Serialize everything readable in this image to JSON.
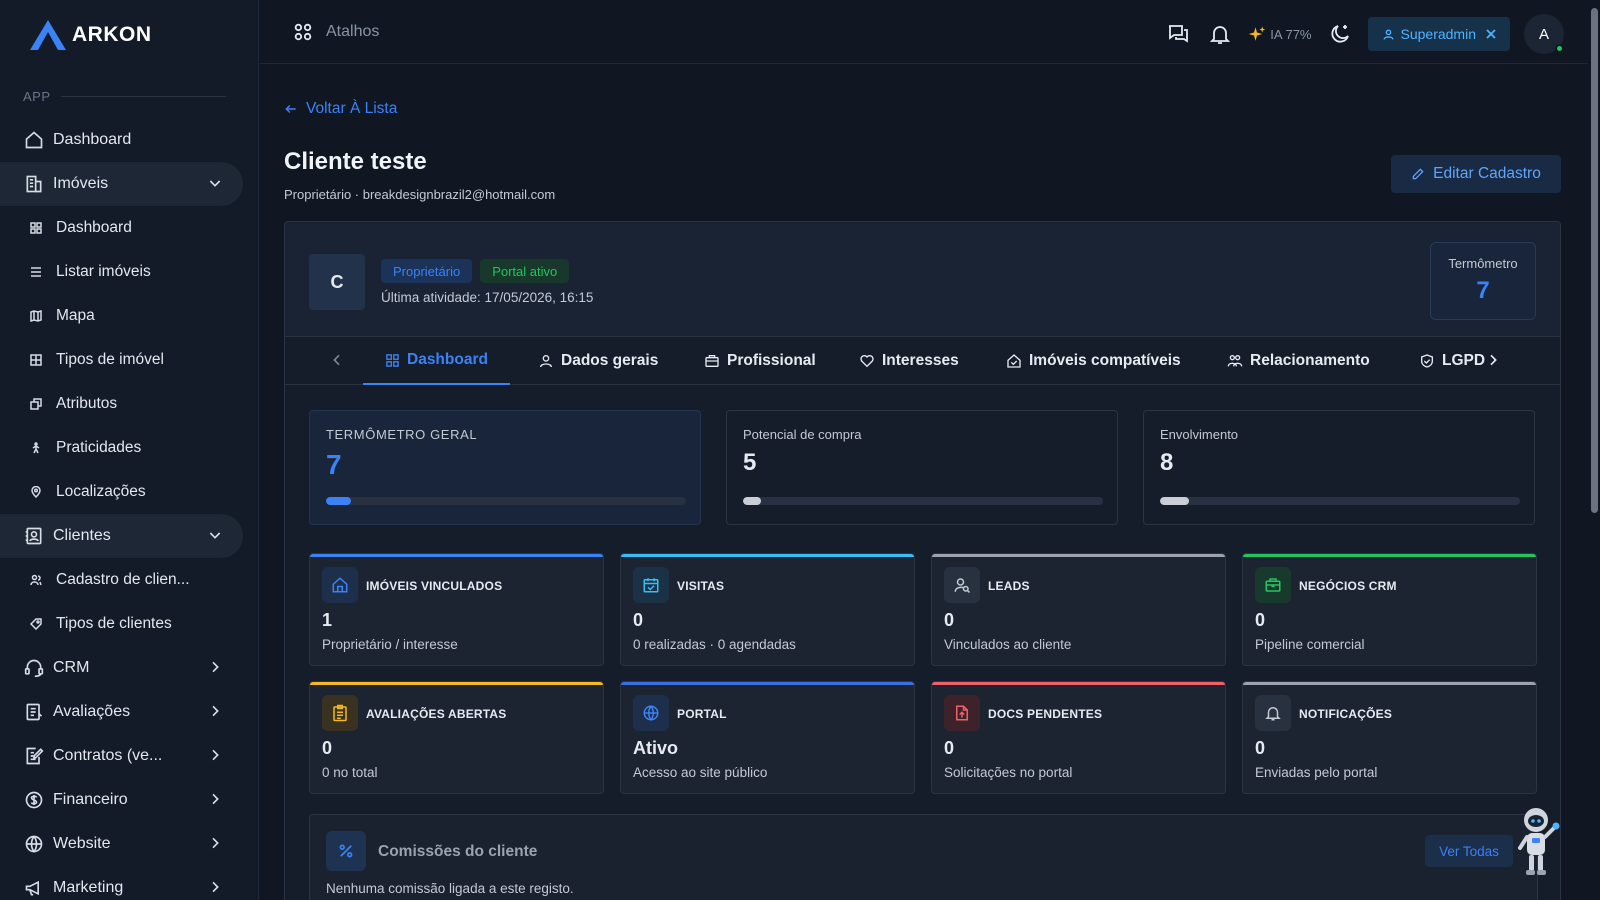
{
  "brand": {
    "name": "ARKON",
    "accent": "#3b82f6"
  },
  "sidebar": {
    "section": "APP",
    "items": [
      {
        "label": "Dashboard",
        "icon": "home-icon",
        "type": "top"
      },
      {
        "label": "Imóveis",
        "icon": "building-icon",
        "type": "top",
        "expanded": true
      },
      {
        "label": "Dashboard",
        "icon": "grid-icon",
        "type": "sub"
      },
      {
        "label": "Listar imóveis",
        "icon": "list-icon",
        "type": "sub"
      },
      {
        "label": "Mapa",
        "icon": "map-icon",
        "type": "sub"
      },
      {
        "label": "Tipos de imóvel",
        "icon": "table-icon",
        "type": "sub"
      },
      {
        "label": "Atributos",
        "icon": "layers-icon",
        "type": "sub"
      },
      {
        "label": "Praticidades",
        "icon": "walk-icon",
        "type": "sub"
      },
      {
        "label": "Localizações",
        "icon": "pin-icon",
        "type": "sub"
      },
      {
        "label": "Clientes",
        "icon": "contacts-icon",
        "type": "top",
        "expanded": true
      },
      {
        "label": "Cadastro de clien...",
        "icon": "users-icon",
        "type": "sub"
      },
      {
        "label": "Tipos de clientes",
        "icon": "tag-icon",
        "type": "sub"
      },
      {
        "label": "CRM",
        "icon": "headset-icon",
        "type": "top"
      },
      {
        "label": "Avaliações",
        "icon": "clipboard-icon",
        "type": "top"
      },
      {
        "label": "Contratos (ve...",
        "icon": "contract-icon",
        "type": "top"
      },
      {
        "label": "Financeiro",
        "icon": "dollar-icon",
        "type": "top"
      },
      {
        "label": "Website",
        "icon": "globe-icon",
        "type": "top"
      },
      {
        "label": "Marketing",
        "icon": "megaphone-icon",
        "type": "top"
      }
    ]
  },
  "topbar": {
    "shortcuts_label": "Atalhos",
    "ia_label": "IA 77%",
    "role_label": "Superadmin",
    "avatar_initial": "A"
  },
  "page": {
    "back_label": "Voltar À Lista",
    "title": "Cliente teste",
    "subtitle": "Proprietário · breakdesignbrazil2@hotmail.com",
    "edit_label": "Editar Cadastro"
  },
  "profile": {
    "initial": "C",
    "badge_role": "Proprietário",
    "badge_portal": "Portal ativo",
    "last_activity": "Última atividade: 17/05/2026, 16:15",
    "thermo_label": "Termômetro",
    "thermo_value": "7"
  },
  "tabs": [
    {
      "label": "Dashboard",
      "icon": "grid-icon"
    },
    {
      "label": "Dados gerais",
      "icon": "user-icon"
    },
    {
      "label": "Profissional",
      "icon": "briefcase-icon"
    },
    {
      "label": "Interesses",
      "icon": "heart-icon"
    },
    {
      "label": "Imóveis compatíveis",
      "icon": "home-check-icon"
    },
    {
      "label": "Relacionamento",
      "icon": "people-icon"
    },
    {
      "label": "LGPD",
      "icon": "shield-icon"
    }
  ],
  "metrics": [
    {
      "label": "TERMÔMETRO GERAL",
      "value": "7",
      "progress": 0.07
    },
    {
      "label": "Potencial de compra",
      "value": "5",
      "progress": 0.05
    },
    {
      "label": "Envolvimento",
      "value": "8",
      "progress": 0.08
    }
  ],
  "stats": [
    {
      "title": "IMÓVEIS VINCULADOS",
      "value": "1",
      "sub": "Proprietário / interesse",
      "color": "#3b82f6",
      "icon": "home-icon"
    },
    {
      "title": "VISITAS",
      "value": "0",
      "sub": "0 realizadas · 0 agendadas",
      "color": "#38bdf8",
      "icon": "calendar-icon"
    },
    {
      "title": "LEADS",
      "value": "0",
      "sub": "Vinculados ao cliente",
      "color": "#9ca3af",
      "icon": "user-search-icon"
    },
    {
      "title": "NEGÓCIOS CRM",
      "value": "0",
      "sub": "Pipeline comercial",
      "color": "#22c55e",
      "icon": "briefcase-icon"
    },
    {
      "title": "AVALIAÇÕES ABERTAS",
      "value": "0",
      "sub": "0 no total",
      "color": "#f5b81f",
      "icon": "clipboard-icon"
    },
    {
      "title": "PORTAL",
      "value": "Ativo",
      "sub": "Acesso ao site público",
      "color": "#3b6fe0",
      "icon": "globe-icon"
    },
    {
      "title": "DOCS PENDENTES",
      "value": "0",
      "sub": "Solicitações no portal",
      "color": "#f0606a",
      "icon": "file-upload-icon"
    },
    {
      "title": "NOTIFICAÇÕES",
      "value": "0",
      "sub": "Enviadas pelo portal",
      "color": "#9ca3af",
      "icon": "bell-icon"
    }
  ],
  "commissions": {
    "title": "Comissões do cliente",
    "empty": "Nenhuma comissão ligada a este registo.",
    "view_all": "Ver Todas"
  }
}
